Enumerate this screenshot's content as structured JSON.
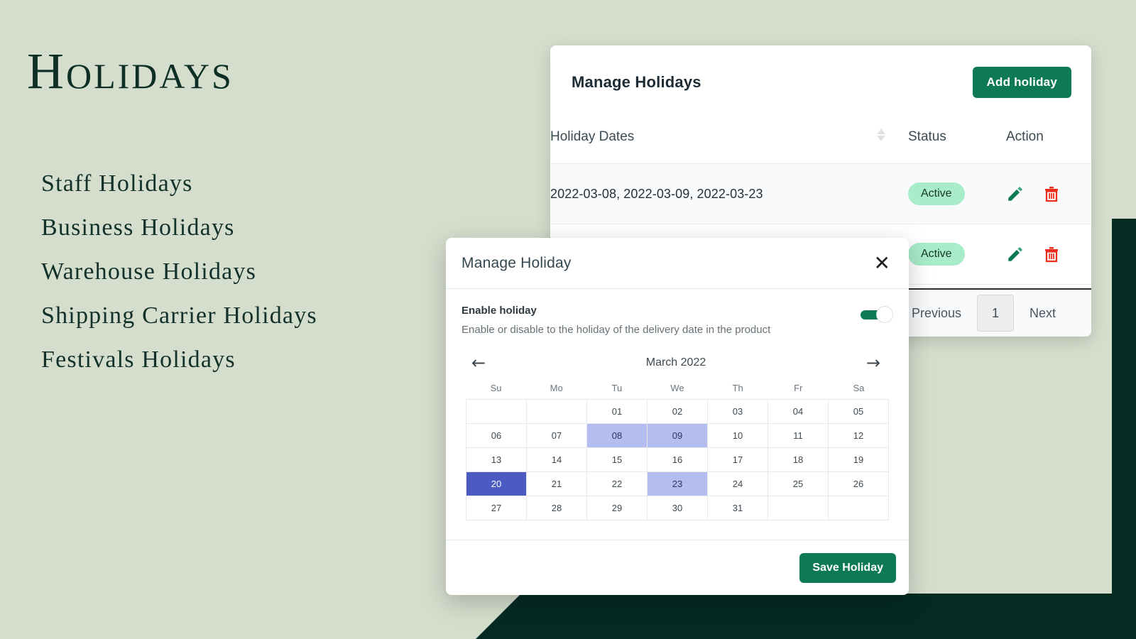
{
  "page": {
    "background_color": "#d5ddcd",
    "accent_color": "#0d7a55",
    "dark_panel_color": "#042b22"
  },
  "hero": {
    "title": "Holidays",
    "items": [
      "Staff Holidays",
      "Business Holidays",
      "Warehouse Holidays",
      "Shipping Carrier Holidays",
      "Festivals Holidays"
    ]
  },
  "card": {
    "title": "Manage Holidays",
    "add_button": "Add holiday",
    "columns": {
      "dates": "Holiday Dates",
      "status": "Status",
      "action": "Action"
    },
    "rows": [
      {
        "dates": "2022-03-08, 2022-03-09, 2022-03-23",
        "status": "Active"
      },
      {
        "dates": "",
        "status": "Active"
      }
    ],
    "pagination": {
      "previous": "Previous",
      "page": "1",
      "next": "Next"
    }
  },
  "modal": {
    "title": "Manage Holiday",
    "close_label": "✕",
    "enable": {
      "label": "Enable holiday",
      "description": "Enable or disable to the holiday of the delivery date in the product",
      "state": "on"
    },
    "calendar": {
      "month_label": "March 2022",
      "prev_arrow": "←",
      "next_arrow": "→",
      "weekdays": [
        "Su",
        "Mo",
        "Tu",
        "We",
        "Th",
        "Fr",
        "Sa"
      ],
      "leading_blanks": 2,
      "days": [
        "01",
        "02",
        "03",
        "04",
        "05",
        "06",
        "07",
        "08",
        "09",
        "10",
        "11",
        "12",
        "13",
        "14",
        "15",
        "16",
        "17",
        "18",
        "19",
        "20",
        "21",
        "22",
        "23",
        "24",
        "25",
        "26",
        "27",
        "28",
        "29",
        "30",
        "31"
      ],
      "selected": [
        "08",
        "09",
        "23"
      ],
      "today": "20",
      "selected_color": "#b3bdf0",
      "today_color": "#4c5bc4"
    },
    "save_button": "Save Holiday"
  }
}
